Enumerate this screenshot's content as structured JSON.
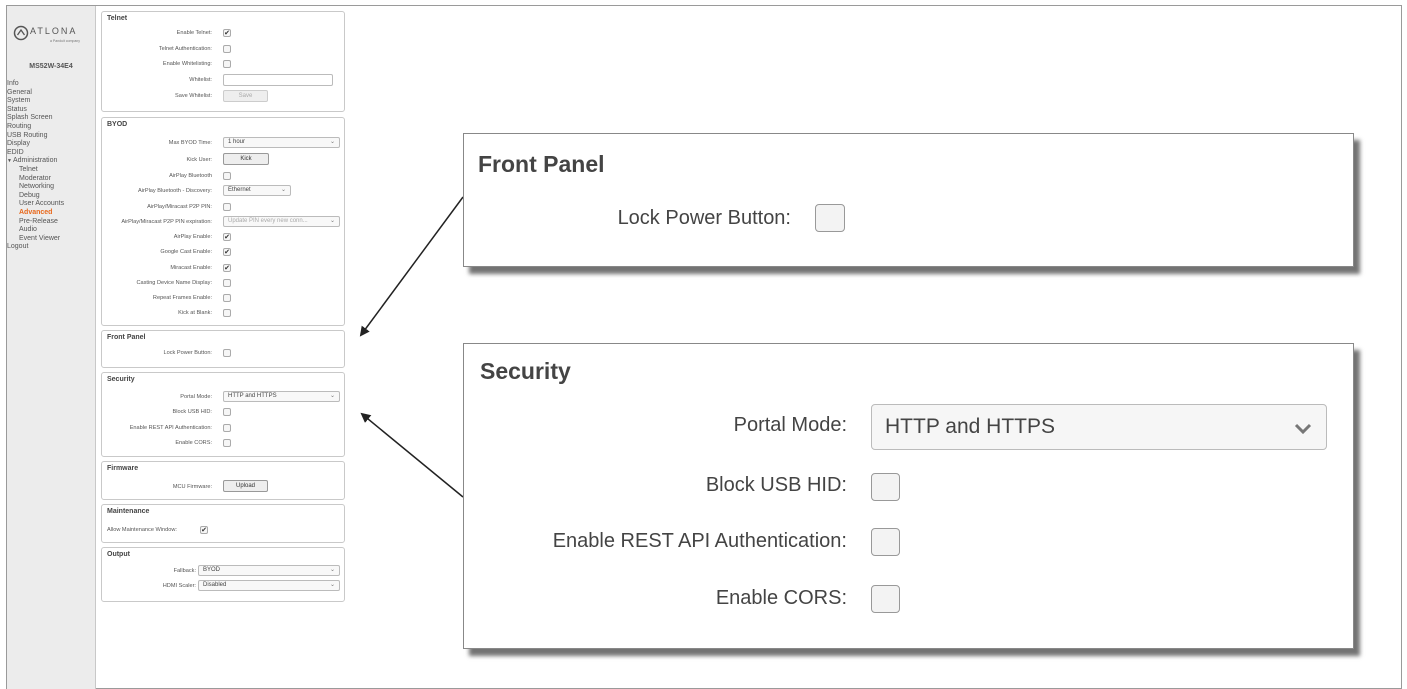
{
  "sidebar": {
    "brand": "ATLONA",
    "brand_sub": "a Panduit company",
    "model": "MS52W-34E4",
    "items": [
      {
        "label": "Info",
        "level": "top"
      },
      {
        "label": "General",
        "level": "top"
      },
      {
        "label": "System",
        "level": "top"
      },
      {
        "label": "Status",
        "level": "top"
      },
      {
        "label": "Splash Screen",
        "level": "top"
      },
      {
        "label": "Routing",
        "level": "top"
      },
      {
        "label": "USB Routing",
        "level": "top"
      },
      {
        "label": "Display",
        "level": "top"
      },
      {
        "label": "EDID",
        "level": "top"
      },
      {
        "label": "Administration",
        "level": "top",
        "expanded": true
      },
      {
        "label": "Telnet",
        "level": "sub"
      },
      {
        "label": "Moderator",
        "level": "sub"
      },
      {
        "label": "Networking",
        "level": "sub"
      },
      {
        "label": "Debug",
        "level": "sub"
      },
      {
        "label": "User Accounts",
        "level": "sub"
      },
      {
        "label": "Advanced",
        "level": "sub",
        "active": true
      },
      {
        "label": "Pre-Release",
        "level": "sub"
      },
      {
        "label": "Audio",
        "level": "sub"
      },
      {
        "label": "Event Viewer",
        "level": "sub"
      },
      {
        "label": "Logout",
        "level": "top"
      }
    ]
  },
  "telnet": {
    "title": "Telnet",
    "enable_telnet": {
      "label": "Enable Telnet:",
      "checked": true
    },
    "telnet_auth": {
      "label": "Telnet Authentication:",
      "checked": false
    },
    "enable_whitelisting": {
      "label": "Enable Whitelisting:",
      "checked": false
    },
    "whitelist": {
      "label": "Whitelist:",
      "value": ""
    },
    "save_whitelist": {
      "label": "Save Whitelist:",
      "button": "Save"
    }
  },
  "byod": {
    "title": "BYOD",
    "max_time": {
      "label": "Max BYOD Time:",
      "value": "1 hour"
    },
    "kick_user": {
      "label": "Kick User:",
      "button": "Kick"
    },
    "airplay_bt": {
      "label": "AirPlay Bluetooth",
      "checked": false
    },
    "airplay_bt_discovery": {
      "label": "AirPlay Bluetooth - Discovery:",
      "value": "Ethernet"
    },
    "p2p_pin": {
      "label": "AirPlay/Miracast P2P PIN:",
      "checked": false
    },
    "p2p_pin_exp": {
      "label": "AirPlay/Miracast P2P PIN expiration:",
      "value": "Update PIN every new conn..."
    },
    "airplay_enable": {
      "label": "AirPlay Enable:",
      "checked": true
    },
    "google_cast": {
      "label": "Google Cast Enable:",
      "checked": true
    },
    "miracast": {
      "label": "Miracast Enable:",
      "checked": true
    },
    "casting_name": {
      "label": "Casting Device Name Display:",
      "checked": false
    },
    "repeat_frames": {
      "label": "Repeat Frames Enable:",
      "checked": false
    },
    "kick_blank": {
      "label": "Kick at Blank:",
      "checked": false
    }
  },
  "front_panel": {
    "title": "Front Panel",
    "lock_power": {
      "label": "Lock Power Button:",
      "checked": false
    }
  },
  "security": {
    "title": "Security",
    "portal_mode": {
      "label": "Portal Mode:",
      "value": "HTTP and HTTPS"
    },
    "block_usb": {
      "label": "Block USB HID:",
      "checked": false
    },
    "rest_auth": {
      "label": "Enable REST API Authentication:",
      "checked": false
    },
    "cors": {
      "label": "Enable CORS:",
      "checked": false
    }
  },
  "firmware": {
    "title": "Firmware",
    "mcu": {
      "label": "MCU Firmware:",
      "button": "Upload"
    }
  },
  "maintenance": {
    "title": "Maintenance",
    "allow": {
      "label": "Allow Maintenance Window:",
      "checked": true
    }
  },
  "output": {
    "title": "Output",
    "fallback": {
      "label": "Fallback:",
      "value": "BYOD"
    },
    "hdmi_scaler": {
      "label": "HDMI Scaler:",
      "value": "Disabled"
    }
  },
  "glyphs": {
    "check": "✔",
    "caret": "⌄"
  }
}
